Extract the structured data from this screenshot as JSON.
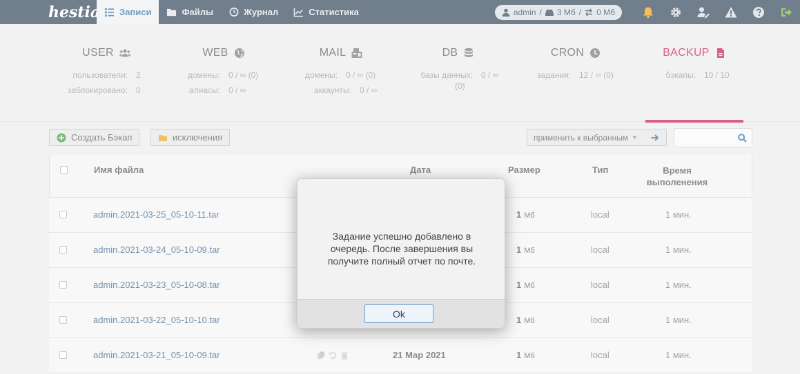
{
  "nav": {
    "logo": "hestia",
    "tabs": [
      {
        "label": "Записи",
        "icon": "list-icon"
      },
      {
        "label": "Файлы",
        "icon": "folder-icon"
      },
      {
        "label": "Журнал",
        "icon": "history-icon"
      },
      {
        "label": "Статистика",
        "icon": "chart-icon"
      }
    ],
    "user": {
      "name": "admin",
      "sep1": "/",
      "disk": "3 Мб",
      "sep2": "/",
      "bandwidth": "0 Мб"
    },
    "icons": [
      "bell-icon",
      "gear-icon",
      "user-edit-icon",
      "warning-icon",
      "help-icon",
      "logout-icon"
    ]
  },
  "stats": [
    {
      "title": "USER",
      "icon": "users-icon",
      "rows": [
        {
          "k": "пользователи:",
          "v": "2"
        },
        {
          "k": "заблокировано:",
          "v": "0"
        }
      ]
    },
    {
      "title": "WEB",
      "icon": "globe-icon",
      "rows": [
        {
          "k": "домены:",
          "v": "0 / ∞ (0)"
        },
        {
          "k": "алиасы:",
          "v": "0 / ∞"
        }
      ]
    },
    {
      "title": "MAIL",
      "icon": "mail-icon",
      "rows": [
        {
          "k": "домены:",
          "v": "0 / ∞ (0)"
        },
        {
          "k": "аккаунты:",
          "v": "0 / ∞"
        }
      ]
    },
    {
      "title": "DB",
      "icon": "database-icon",
      "rows": [
        {
          "k": "базы данных:",
          "v": "0 / ∞"
        },
        {
          "k": "",
          "v": "(0)"
        }
      ]
    },
    {
      "title": "CRON",
      "icon": "clock-icon",
      "rows": [
        {
          "k": "задания:",
          "v": "12 / ∞ (0)"
        }
      ]
    },
    {
      "title": "BACKUP",
      "icon": "file-icon",
      "rows": [
        {
          "k": "бэкапы:",
          "v": "10 / 10"
        }
      ]
    }
  ],
  "toolbar": {
    "create_backup": "Создать Бэкап",
    "exclusions": "исключения",
    "bulk_action": "применить к выбранным",
    "search_placeholder": ""
  },
  "table": {
    "headers": {
      "filename": "Имя файла",
      "date": "Дата",
      "size": "Размер",
      "type": "Тип",
      "time_line1": "Время",
      "time_line2": "выполенения"
    },
    "rows": [
      {
        "filename": "admin.2021-03-25_05-10-11.tar",
        "date": "",
        "size": "1",
        "unit": "Мб",
        "type": "local",
        "time": "1 мин."
      },
      {
        "filename": "admin.2021-03-24_05-10-09.tar",
        "date": "",
        "size": "1",
        "unit": "Мб",
        "type": "local",
        "time": "1 мин."
      },
      {
        "filename": "admin.2021-03-23_05-10-08.tar",
        "date": "",
        "size": "1",
        "unit": "Мб",
        "type": "local",
        "time": "1 мин."
      },
      {
        "filename": "admin.2021-03-22_05-10-10.tar",
        "date": "",
        "size": "1",
        "unit": "Мб",
        "type": "local",
        "time": "1 мин."
      },
      {
        "filename": "admin.2021-03-21_05-10-09.tar",
        "date": "21  Мар  2021",
        "size": "1",
        "unit": "Мб",
        "type": "local",
        "time": "1 мин."
      }
    ]
  },
  "modal": {
    "message": "Задание успешно добавлено в очередь. После завершения вы получите полный отчет по почте.",
    "ok_label": "Ok"
  },
  "colors": {
    "nav_bg": "#2e4155",
    "accent": "#c7144d",
    "link": "#2f5f8a",
    "page_bg": "#ececec"
  }
}
